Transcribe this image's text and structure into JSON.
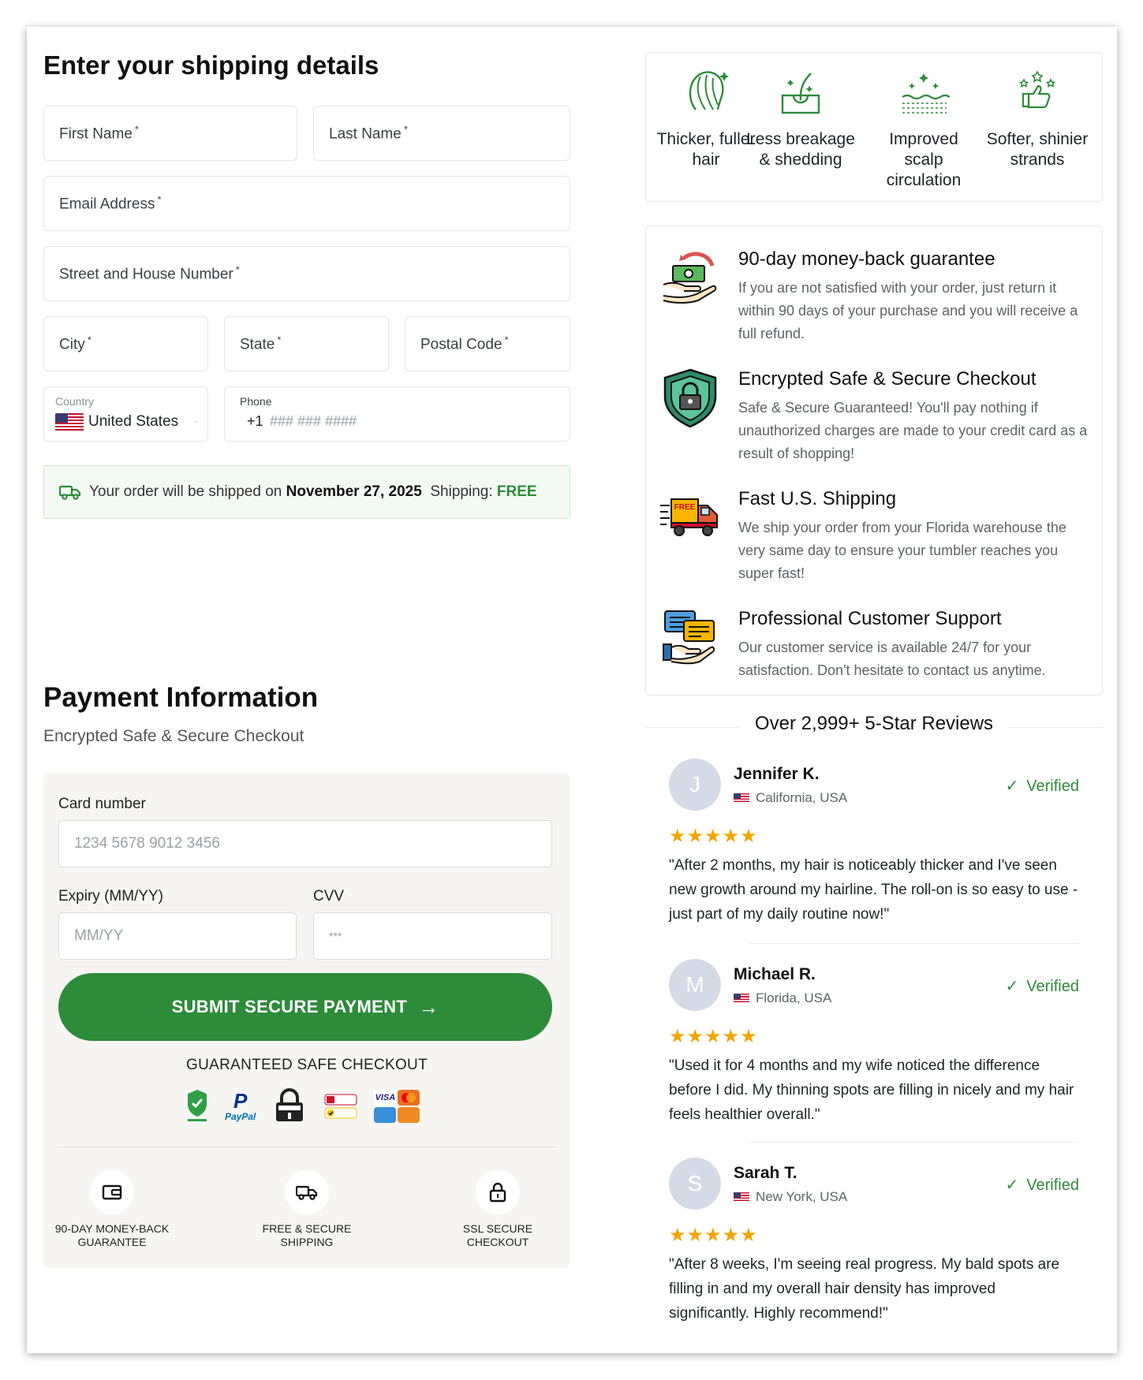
{
  "shipping": {
    "title": "Enter your shipping details",
    "first_name": "First Name",
    "last_name": "Last Name",
    "email": "Email Address",
    "street": "Street and House Number",
    "city": "City",
    "state": "State",
    "postal": "Postal Code",
    "required_mark": "*",
    "country_label": "Country",
    "country_value": "United States",
    "phone_label": "Phone",
    "phone_prefix": "+1",
    "phone_placeholder": "### ### ####",
    "banner_prefix": "Your order will be shipped on",
    "banner_date": "November 27, 2025",
    "banner_shipping": "Shipping:",
    "banner_free": "FREE"
  },
  "payment": {
    "title": "Payment Information",
    "subtitle": "Encrypted Safe & Secure Checkout",
    "card_label": "Card number",
    "card_placeholder": "1234 5678 9012 3456",
    "expiry_label": "Expiry (MM/YY)",
    "expiry_placeholder": "MM/YY",
    "cvv_label": "CVV",
    "cvv_placeholder": "***",
    "submit_label": "SUBMIT SECURE PAYMENT",
    "guaranteed": "GUARANTEED SAFE CHECKOUT",
    "paypal": "PayPal",
    "visa": "VISA",
    "guarantees": [
      {
        "label": "90-DAY MONEY-BACK GUARANTEE"
      },
      {
        "label": "FREE & SECURE SHIPPING"
      },
      {
        "label": "SSL SECURE CHECKOUT"
      }
    ]
  },
  "benefits": [
    {
      "label": "Thicker, fuller hair"
    },
    {
      "label": "Less breakage & shedding"
    },
    {
      "label": "Improved scalp circulation"
    },
    {
      "label": "Softer, shinier strands"
    }
  ],
  "trust": [
    {
      "title": "90-day money-back guarantee",
      "desc": "If you are not satisfied with your order, just return it within 90 days of your purchase and you will receive a full refund."
    },
    {
      "title": "Encrypted Safe & Secure Checkout",
      "desc": "Safe & Secure Guaranteed! You'll pay nothing if unauthorized charges are made to your credit card as a result of shopping!"
    },
    {
      "title": "Fast U.S. Shipping",
      "desc": "We ship your order from your Florida warehouse the very same day to ensure your tumbler reaches you super fast!",
      "badge": "FREE"
    },
    {
      "title": "Professional Customer Support",
      "desc": "Our customer service is available 24/7 for your satisfaction. Don't hesitate to contact us anytime."
    }
  ],
  "reviews": {
    "heading": "Over 2,999+ 5-Star Reviews",
    "verified": "Verified",
    "stars": "★★★★★",
    "items": [
      {
        "initial": "J",
        "name": "Jennifer K.",
        "location": "California, USA",
        "quote": "\"After 2 months, my hair is noticeably thicker and I've seen new growth around my hairline. The roll-on is so easy to use - just part of my daily routine now!\""
      },
      {
        "initial": "M",
        "name": "Michael R.",
        "location": "Florida, USA",
        "quote": "\"Used it for 4 months and my wife noticed the difference before I did. My thinning spots are filling in nicely and my hair feels healthier overall.\""
      },
      {
        "initial": "S",
        "name": "Sarah T.",
        "location": "New York, USA",
        "quote": "\"After 8 weeks, I'm seeing real progress. My bald spots are filling in and my overall hair density has improved significantly. Highly recommend!\""
      }
    ]
  },
  "colors": {
    "accent": "#2e8b3a",
    "star": "#f0a500"
  }
}
